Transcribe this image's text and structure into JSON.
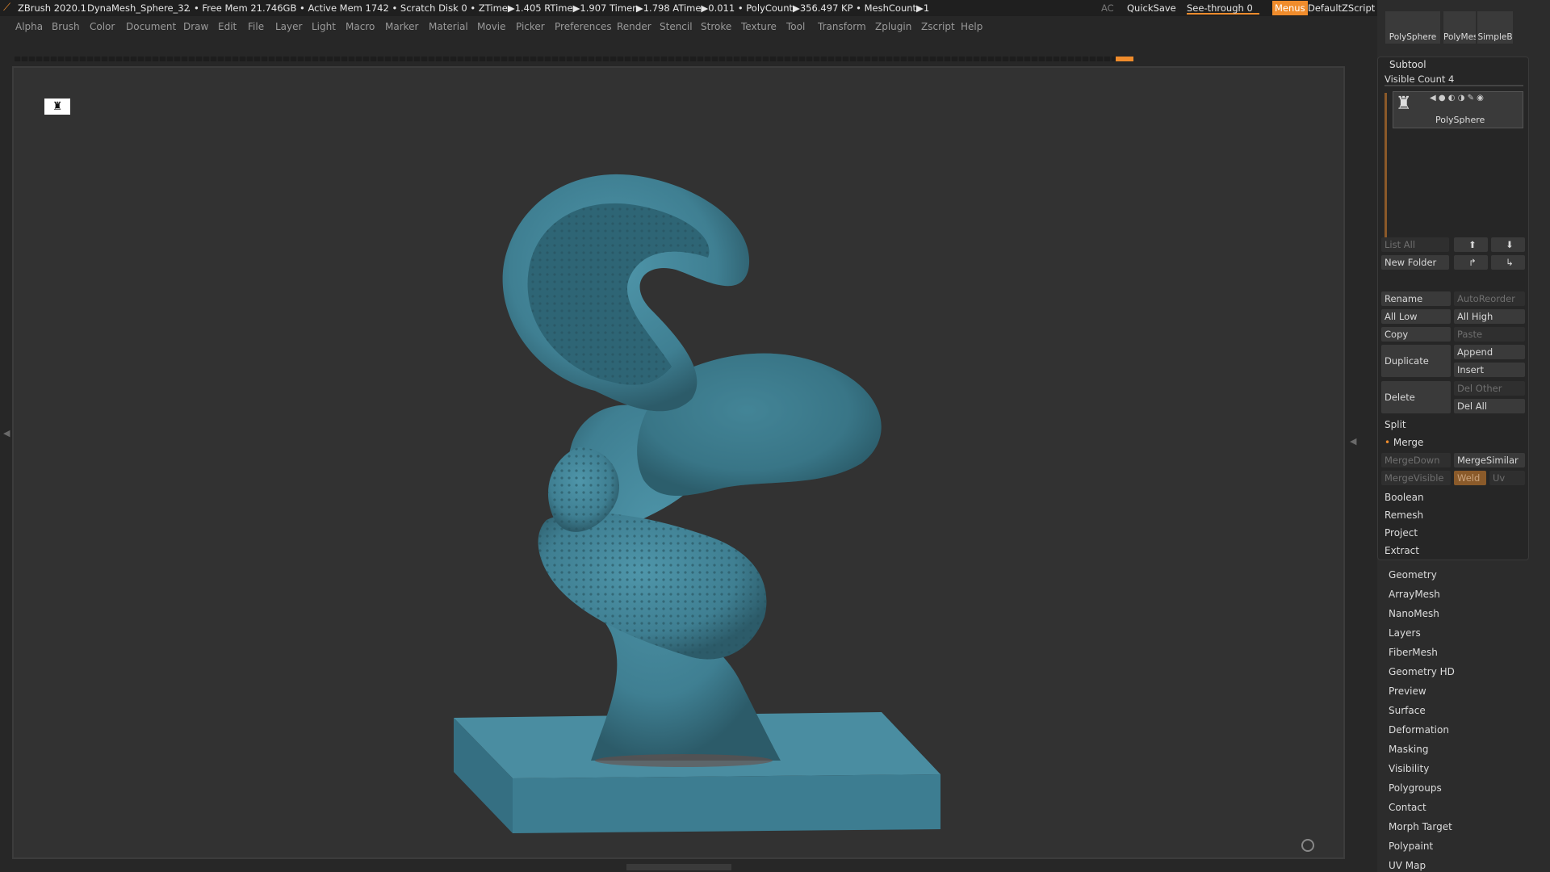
{
  "titlebar": {
    "app": "ZBrush 2020.1",
    "file": "DynaMesh_Sphere_32",
    "status": ".. • Free Mem 21.746GB • Active Mem 1742 • Scratch Disk 0 • ZTime▶1.405 RTime▶1.907 Timer▶1.798 ATime▶0.011 • PolyCount▶356.497 KP • MeshCount▶1",
    "ac": "AC",
    "quicksave": "QuickSave",
    "seethrough": "See-through",
    "seethrough_value": "0",
    "menus": "Menus",
    "script": "DefaultZScript"
  },
  "menubar": [
    "Alpha",
    "Brush",
    "Color",
    "Document",
    "Draw",
    "Edit",
    "File",
    "Layer",
    "Light",
    "Macro",
    "Marker",
    "Material",
    "Movie",
    "Picker",
    "Preferences",
    "Render",
    "Stencil",
    "Stroke",
    "Texture",
    "Tool",
    "Transform",
    "Zplugin",
    "Zscript",
    "Help"
  ],
  "tools": {
    "a": "PolySphere",
    "b": "PolyMes",
    "c": "SimpleB"
  },
  "subtool": {
    "title": "Subtool",
    "visible": "Visible Count 4",
    "item": "PolySphere",
    "listall": "List All",
    "newfolder": "New Folder",
    "rename": "Rename",
    "autoreorder": "AutoReorder",
    "alllow": "All Low",
    "allhigh": "All High",
    "copy": "Copy",
    "paste": "Paste",
    "duplicate": "Duplicate",
    "append": "Append",
    "insert": "Insert",
    "delete": "Delete",
    "delother": "Del Other",
    "delall": "Del All",
    "split": "Split",
    "merge": "Merge",
    "mergedown": "MergeDown",
    "mergesimilar": "MergeSimilar",
    "mergevisible": "MergeVisible",
    "weld": "Weld",
    "uv": "Uv",
    "boolean": "Boolean",
    "remesh": "Remesh",
    "project": "Project",
    "extract": "Extract"
  },
  "sections": [
    "Geometry",
    "ArrayMesh",
    "NanoMesh",
    "Layers",
    "FiberMesh",
    "Geometry HD",
    "Preview",
    "Surface",
    "Deformation",
    "Masking",
    "Visibility",
    "Polygroups",
    "Contact",
    "Morph Target",
    "Polypaint",
    "UV Map"
  ],
  "colors": {
    "accent": "#f08c2c",
    "model": "#3f7f92"
  }
}
